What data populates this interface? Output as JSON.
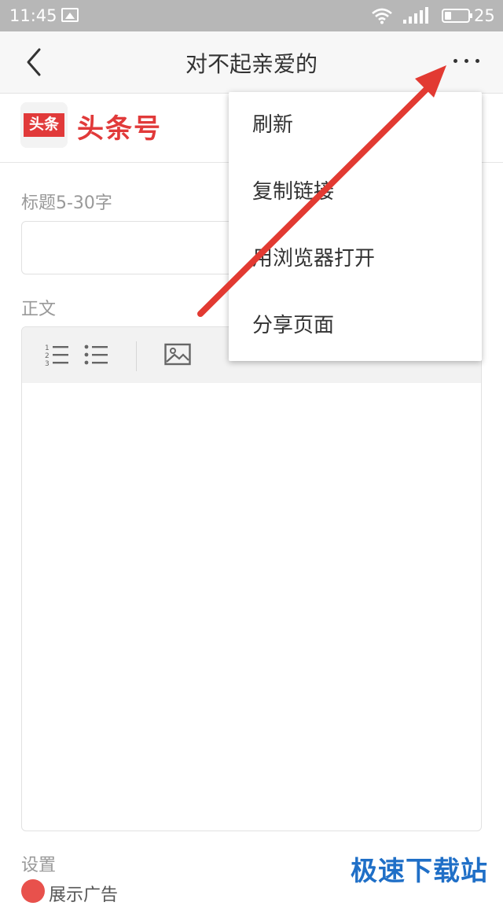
{
  "status_bar": {
    "time": "11:45",
    "battery_level": "25",
    "icons": [
      "gallery-icon",
      "wifi-icon",
      "signal-icon",
      "battery-icon"
    ]
  },
  "title_bar": {
    "title": "对不起亲爱的",
    "back_icon": "chevron-left-icon",
    "more_icon": "more-horizontal-icon"
  },
  "brand": {
    "logo_text": "头条",
    "name": "头条号",
    "color": "#e13a3a"
  },
  "form": {
    "title_label": "标题5-30字",
    "title_value": "",
    "body_label": "正文",
    "body_value": "",
    "toolbar_icons": [
      "ordered-list-icon",
      "bullet-list-icon",
      "image-icon"
    ],
    "settings_label": "设置",
    "show_ads_label": "展示广告",
    "show_ads_checked": true
  },
  "menu": {
    "items": [
      {
        "label": "刷新"
      },
      {
        "label": "复制链接"
      },
      {
        "label": "用浏览器打开"
      },
      {
        "label": "分享页面"
      }
    ]
  },
  "watermark": "极速下载站",
  "annotation": {
    "type": "arrow",
    "color": "#e23a32",
    "points_to": "more-button"
  }
}
